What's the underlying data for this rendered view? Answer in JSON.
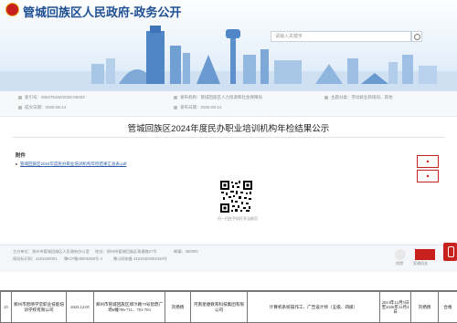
{
  "header": {
    "site_title": "管城回族区人民政府-政务公开",
    "search_placeholder": "请输入关键字"
  },
  "meta": {
    "row1": [
      {
        "label": "索引号",
        "value": "005275160/2025-00034"
      },
      {
        "label": "发布机构",
        "value": "管城回族区人力资源和社会保障局"
      },
      {
        "label": "主题分类",
        "value": "劳动就业和培训、其他"
      }
    ],
    "row2": [
      {
        "label": "成文日期",
        "value": "2025-06-12"
      },
      {
        "label": "发布日期",
        "value": "2025-06-12"
      }
    ]
  },
  "document": {
    "title": "管城回族区2024年度民办职业培训机构年检结果公示",
    "attachment_label": "附件",
    "attachment_link": "管城回族区2024年度民办职业培训机构年检结果汇总表.pdf",
    "qr_caption": "扫一扫在手机打开当前页"
  },
  "footer": {
    "host_label": "主办单位：",
    "host_value": "郑州市管城回族区人民政府办公室",
    "address_label": "地址：",
    "address_value": "郑州市管城回族区政通路27号",
    "postal_label": "邮编：",
    "postal_value": "450000",
    "site_code_label": "网站标识码：",
    "site_code_value": "4101040001",
    "icp_value": "豫ICP备05005358号-3",
    "police_value": "豫公网安备 41010402002349号",
    "badge_text_1": "党政机关",
    "badge_text_2": "找错"
  },
  "record_strip": {
    "cells": [
      "25",
      "郑州市智晴学堂职业技能培训学校有限公司",
      "2023.12.05",
      "郑州市管城回族区郑汴路79号智鼎广场6幢706-711、701-703",
      "刘扬扬",
      "河南星捷教育科技集团有限公司",
      "计算机系统操作工、广告设计师（五级、四级）",
      "2023年12月5日至2026年12月4日",
      "刘扬扬",
      "合格"
    ]
  }
}
